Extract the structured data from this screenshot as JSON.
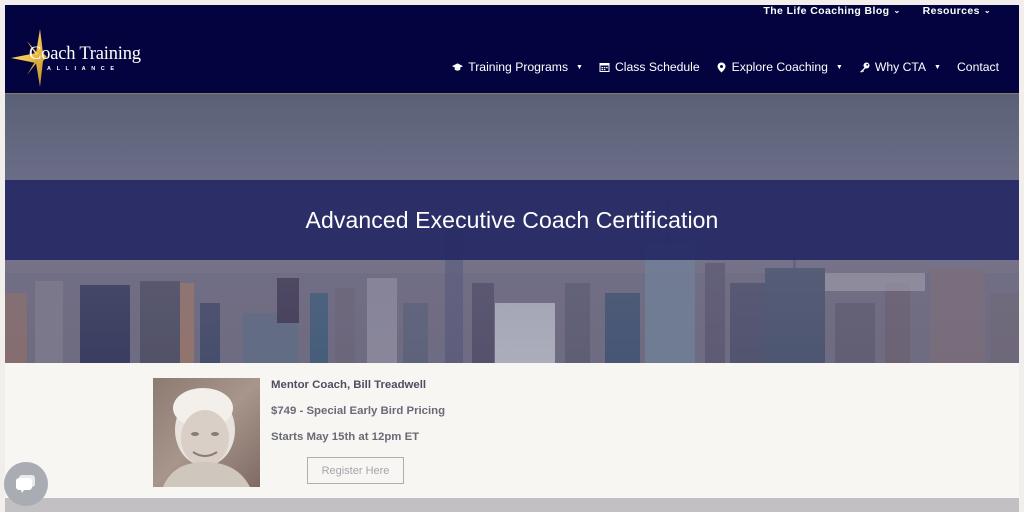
{
  "brand": {
    "name_main": "Coach Training",
    "name_sub": "ALLIANCE",
    "star_color": "#f0c24a",
    "header_bg": "#03043f"
  },
  "topbar": {
    "items": [
      {
        "label": "The Life Coaching Blog",
        "icon": "chevron-down-icon"
      },
      {
        "label": "Resources",
        "icon": "chevron-down-icon"
      }
    ]
  },
  "nav": {
    "items": [
      {
        "label": "Training Programs",
        "icon": "graduation-cap-icon",
        "glyph": "🎓",
        "has_dropdown": true
      },
      {
        "label": "Class Schedule",
        "icon": "calendar-icon",
        "glyph": "▦",
        "has_dropdown": false
      },
      {
        "label": "Explore Coaching",
        "icon": "map-pin-icon",
        "glyph": "⚲",
        "has_dropdown": true
      },
      {
        "label": "Why CTA",
        "icon": "key-icon",
        "glyph": "⚷",
        "has_dropdown": true
      },
      {
        "label": "Contact",
        "has_dropdown": false
      }
    ],
    "caret_glyph": "▼",
    "chevron_glyph": "⌄"
  },
  "hero": {
    "title": "Advanced Executive Coach Certification"
  },
  "course": {
    "mentor": "Mentor Coach, Bill Treadwell",
    "price": "$749 - Special Early Bird Pricing",
    "start": "Starts May 15th at 12pm ET",
    "register_label": "Register Here"
  },
  "chat": {
    "icon": "chat-bubble-icon"
  }
}
